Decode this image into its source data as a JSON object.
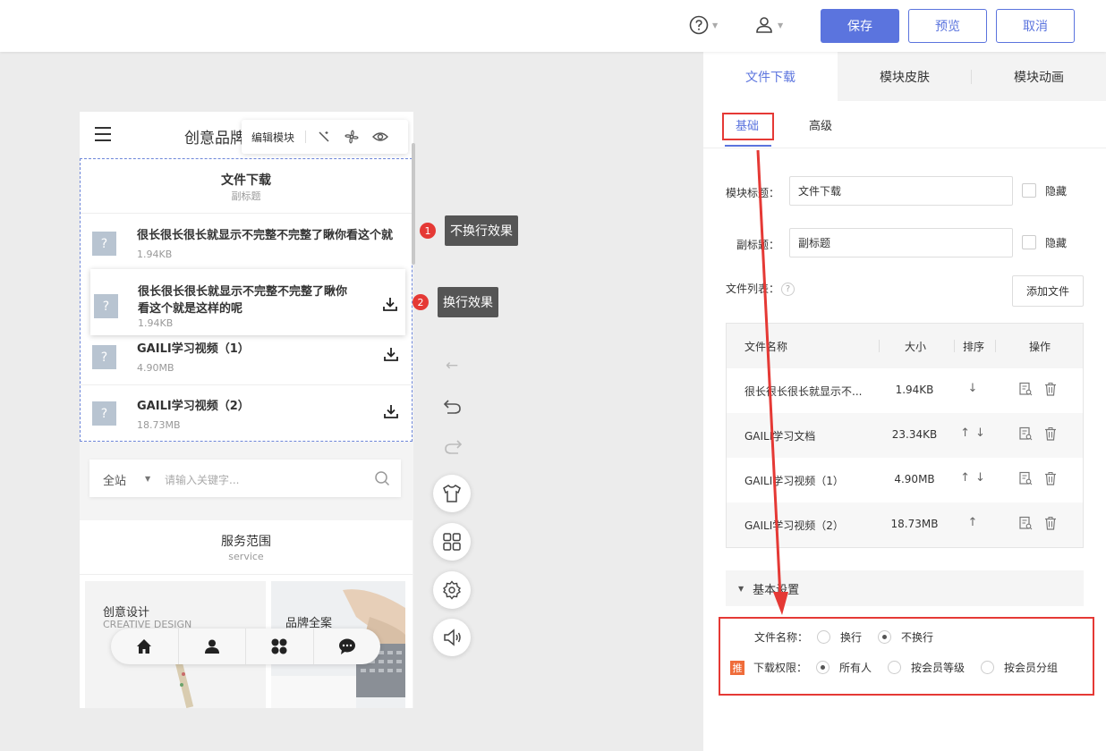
{
  "topbar": {
    "save_label": "保存",
    "preview_label": "预览",
    "cancel_label": "取消"
  },
  "phone": {
    "site_title": "创意品牌",
    "edit_toolbar": {
      "label": "编辑模块"
    },
    "module": {
      "title": "文件下载",
      "subtitle": "副标题",
      "files": [
        {
          "name": "很长很长很长就显示不完整不完整了瞅你看这个就",
          "size": "1.94KB"
        },
        {
          "name_line1": "很长很长很长就显示不完整不完整了瞅你",
          "name_line2": "看这个就是这样的呢",
          "size": "1.94KB"
        },
        {
          "name": "GAILI学习视频（1）",
          "size": "4.90MB"
        },
        {
          "name": "GAILI学习视频（2）",
          "size": "18.73MB"
        }
      ]
    },
    "search": {
      "scope": "全站",
      "placeholder": "请输入关键字..."
    },
    "service": {
      "title": "服务范围",
      "subtitle": "service",
      "card1_title": "创意设计",
      "card1_sub": "CREATIVE DESIGN",
      "card2_title": "品牌全案"
    }
  },
  "callouts": [
    {
      "num": "1",
      "text": "不换行效果"
    },
    {
      "num": "2",
      "text": "换行效果"
    }
  ],
  "panel": {
    "tabs": [
      "文件下载",
      "模块皮肤",
      "模块动画"
    ],
    "subtabs": [
      "基础",
      "高级"
    ],
    "module_title_label": "模块标题：",
    "module_title_value": "文件下载",
    "subtitle_label": "副标题：",
    "subtitle_value": "副标题",
    "hide_label": "隐藏",
    "file_list_label": "文件列表：",
    "add_file_label": "添加文件",
    "table": {
      "headers": [
        "文件名称",
        "大小",
        "排序",
        "操作"
      ],
      "rows": [
        {
          "name": "很长很长很长就显示不...",
          "size": "1.94KB",
          "sort": "↓"
        },
        {
          "name": "GAILI学习文档",
          "size": "23.34KB",
          "sort": "↑↓"
        },
        {
          "name": "GAILI学习视频（1）",
          "size": "4.90MB",
          "sort": "↑↓"
        },
        {
          "name": "GAILI学习视频（2）",
          "size": "18.73MB",
          "sort": "↑"
        }
      ]
    },
    "basic_settings_label": "基本设置",
    "filename_label": "文件名称：",
    "filename_options": [
      "换行",
      "不换行"
    ],
    "filename_selected": "不换行",
    "badge_text": "推",
    "perm_label": "下载权限：",
    "perm_options": [
      "所有人",
      "按会员等级",
      "按会员分组"
    ],
    "perm_selected": "所有人"
  },
  "colors": {
    "accent": "#5b74de",
    "highlight_red": "#e53935",
    "badge_orange": "#ef6c3a"
  }
}
